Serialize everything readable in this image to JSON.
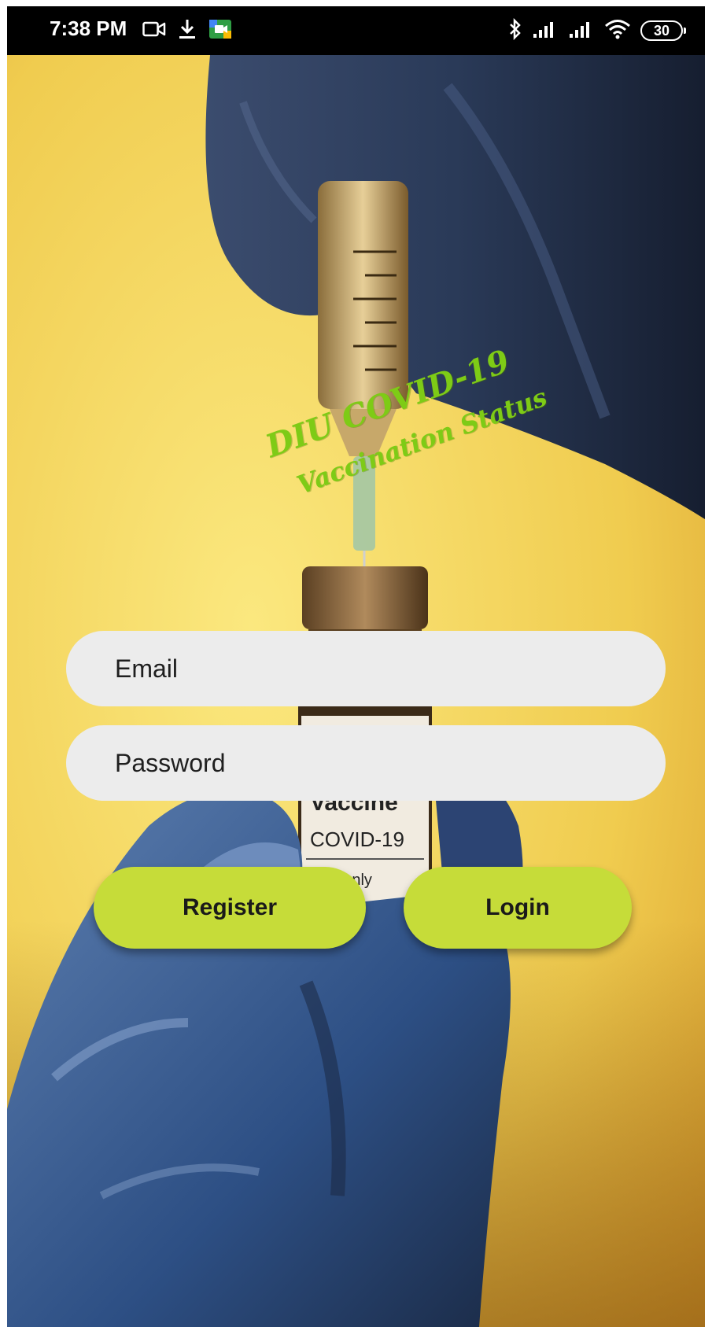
{
  "status_bar": {
    "time": "7:38 PM",
    "battery": "30",
    "left_icons": [
      "video-call-icon",
      "download-icon",
      "meet-app-icon"
    ],
    "right_icons": [
      "bluetooth-icon",
      "signal-icon",
      "signal-icon",
      "wifi-icon",
      "battery-icon"
    ]
  },
  "app": {
    "title_line_1": "DIU COVID-19",
    "title_line_2": "Vaccination Status",
    "title_color": "#7ecb16"
  },
  "form": {
    "email_placeholder": "Email",
    "password_placeholder": "Password"
  },
  "buttons": {
    "register_label": "Register",
    "login_label": "Login",
    "color": "#c6dc39"
  },
  "background": {
    "vial_label_line": "COVID-19",
    "vial_label_partial_top": "Vaccine",
    "vial_label_partial_bottom": "tion Only"
  }
}
